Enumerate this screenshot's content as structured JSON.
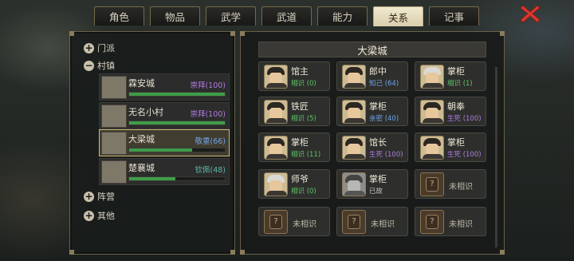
{
  "tabs": [
    {
      "label": "角色",
      "active": false
    },
    {
      "label": "物品",
      "active": false
    },
    {
      "label": "武学",
      "active": false
    },
    {
      "label": "武道",
      "active": false
    },
    {
      "label": "能力",
      "active": false
    },
    {
      "label": "关系",
      "active": true
    },
    {
      "label": "记事",
      "active": false
    }
  ],
  "close_icon": "close-x-icon",
  "left_panel": {
    "categories": [
      {
        "label": "门派",
        "state": "collapsed"
      },
      {
        "label": "村镇",
        "state": "expanded"
      },
      {
        "label": "阵营",
        "state": "collapsed"
      },
      {
        "label": "其他",
        "state": "collapsed"
      }
    ],
    "towns": [
      {
        "name": "霖安城",
        "status": "崇拜",
        "value": "(100)",
        "status_color": "#b07ae0",
        "progress": 1.0,
        "selected": false
      },
      {
        "name": "无名小村",
        "status": "崇拜",
        "value": "(100)",
        "status_color": "#b07ae0",
        "progress": 1.0,
        "selected": false
      },
      {
        "name": "大梁城",
        "status": "敬重",
        "value": "(66)",
        "status_color": "#6fa4e8",
        "progress": 0.66,
        "selected": true
      },
      {
        "name": "楚襄城",
        "status": "钦佩",
        "value": "(48)",
        "status_color": "#5fb8a8",
        "progress": 0.48,
        "selected": false
      }
    ]
  },
  "right_panel": {
    "title": "大梁城",
    "npcs": [
      {
        "name": "馆主",
        "status": "相识 (0)",
        "status_color": "#5fc46a",
        "known": true
      },
      {
        "name": "郎中",
        "status": "知己 (64)",
        "status_color": "#6fa4e8",
        "known": true
      },
      {
        "name": "掌柜",
        "status": "相识 (1)",
        "status_color": "#5fc46a",
        "known": true
      },
      {
        "name": "铁匠",
        "status": "相识 (5)",
        "status_color": "#5fc46a",
        "known": true
      },
      {
        "name": "掌柜",
        "status": "亲密 (40)",
        "status_color": "#6fa4e8",
        "known": true
      },
      {
        "name": "朝奉",
        "status": "生死 (100)",
        "status_color": "#b07ae0",
        "known": true
      },
      {
        "name": "掌柜",
        "status": "相识 (11)",
        "status_color": "#5fc46a",
        "known": true
      },
      {
        "name": "馆长",
        "status": "生死 (100)",
        "status_color": "#b07ae0",
        "known": true
      },
      {
        "name": "掌柜",
        "status": "生死 (100)",
        "status_color": "#b07ae0",
        "known": true
      },
      {
        "name": "师爷",
        "status": "相识 (0)",
        "status_color": "#5fc46a",
        "known": true
      },
      {
        "name": "掌柜",
        "status": "已故",
        "status_color": "#bfbfbf",
        "known": true
      },
      {
        "name": "未相识",
        "status": "",
        "status_color": "#bdb7a8",
        "known": false
      },
      {
        "name": "未相识",
        "status": "",
        "status_color": "#bdb7a8",
        "known": false
      },
      {
        "name": "未相识",
        "status": "",
        "status_color": "#bdb7a8",
        "known": false
      },
      {
        "name": "未相识",
        "status": "",
        "status_color": "#bdb7a8",
        "known": false
      }
    ]
  }
}
